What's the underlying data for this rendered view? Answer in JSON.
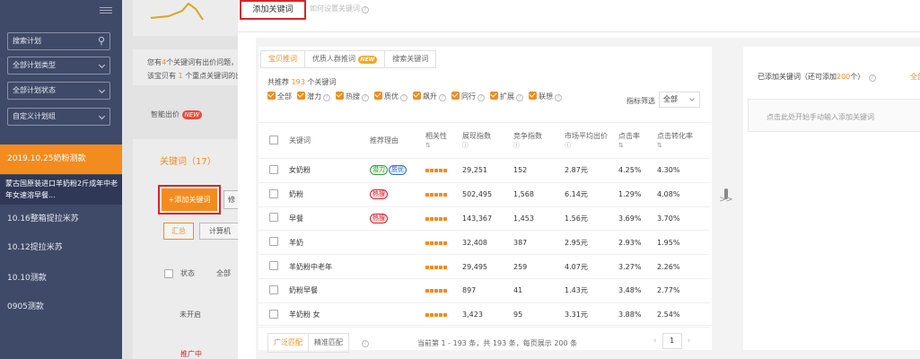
{
  "sidebar": {
    "search_placeholder": "搜索计划",
    "filter_type": "全部计划类型",
    "filter_status": "全部计划状态",
    "filter_group": "自定义计划组",
    "plans": [
      {
        "label": "2019.10.25奶粉测款",
        "active": true
      },
      {
        "label": "蒙古国原装进口羊奶粉2斤成年中老年女速溶早餐...",
        "active": false
      },
      {
        "label": "10.16整箱提拉米苏",
        "active": false
      },
      {
        "label": "10.12提拉米苏",
        "active": false
      },
      {
        "label": "10.10测款",
        "active": false
      },
      {
        "label": "0905测款",
        "active": false
      }
    ]
  },
  "background": {
    "notice_line1_a": "您有",
    "notice_line1_num": "4",
    "notice_line1_b": "个关键词有出价问题，",
    "notice_line2_a": "该宝贝有",
    "notice_line2_num": "1",
    "notice_line2_b": "个重点关键词的出",
    "smart_bid": "智能出价",
    "new_badge": "NEW",
    "keywords_title": "关键词（17）",
    "add_keyword_btn": "+添加关键词",
    "modify_btn": "修",
    "summary_btn": "汇总",
    "computer_btn": "计算机",
    "status_header": "状态",
    "all_header": "全部",
    "status_not_started": "未开启",
    "status_promoting": "推广中"
  },
  "panel": {
    "tab_active": "添加关键词",
    "tab_inactive": "如何设置关键词",
    "subtabs": [
      "宝贝推词",
      "优质人群推词",
      "搜索关键词"
    ],
    "subtab_new": "NEW",
    "reco_prefix": "共推荐",
    "reco_count": "193",
    "reco_suffix": "个关键词",
    "filters": [
      "全部",
      "潜力",
      "热搜",
      "质优",
      "飙升",
      "同行",
      "扩展",
      "联想"
    ],
    "metric_label": "指标筛选",
    "metric_value": "全部",
    "columns": [
      "关键词",
      "推荐理由",
      "相关性",
      "展现指数",
      "竞争指数",
      "市场平均出价",
      "点击率",
      "点击转化率"
    ],
    "rows": [
      {
        "kw": "女奶粉",
        "tags": [
          "潜力",
          "质优"
        ],
        "show": "29,251",
        "comp": "152",
        "bid": "2.87元",
        "ctr": "4.25%",
        "cvr": "4.30%"
      },
      {
        "kw": "奶粉",
        "tags": [
          "热搜"
        ],
        "show": "502,495",
        "comp": "1,568",
        "bid": "6.14元",
        "ctr": "1.29%",
        "cvr": "4.08%"
      },
      {
        "kw": "早餐",
        "tags": [
          "热搜"
        ],
        "show": "143,367",
        "comp": "1,453",
        "bid": "1.56元",
        "ctr": "3.69%",
        "cvr": "3.70%"
      },
      {
        "kw": "羊奶",
        "tags": [],
        "show": "32,408",
        "comp": "387",
        "bid": "2.95元",
        "ctr": "2.93%",
        "cvr": "1.95%"
      },
      {
        "kw": "羊奶粉中老年",
        "tags": [],
        "show": "29,495",
        "comp": "259",
        "bid": "4.07元",
        "ctr": "3.27%",
        "cvr": "2.26%"
      },
      {
        "kw": "奶粉早餐",
        "tags": [],
        "show": "897",
        "comp": "41",
        "bid": "1.43元",
        "ctr": "3.48%",
        "cvr": "2.77%"
      },
      {
        "kw": "羊奶粉 女",
        "tags": [],
        "show": "3,423",
        "comp": "95",
        "bid": "3.31元",
        "ctr": "3.88%",
        "cvr": "2.54%"
      }
    ],
    "match_tabs": [
      "广泛匹配",
      "精准匹配"
    ],
    "page_info": "当前第 1 - 193 条，共 193 条，每页展示 200 条",
    "page_num": "1",
    "move_arrow": ">>",
    "added_prefix": "已添加关键词（还可添加",
    "added_count": "200",
    "added_suffix": "个）",
    "all_link": "全部",
    "manual_hint": "点击此处开始手动输入添加关键词"
  },
  "colors": {
    "accent": "#f28c1e",
    "sidebar": "#3f4a68",
    "highlight": "#d9232b"
  }
}
